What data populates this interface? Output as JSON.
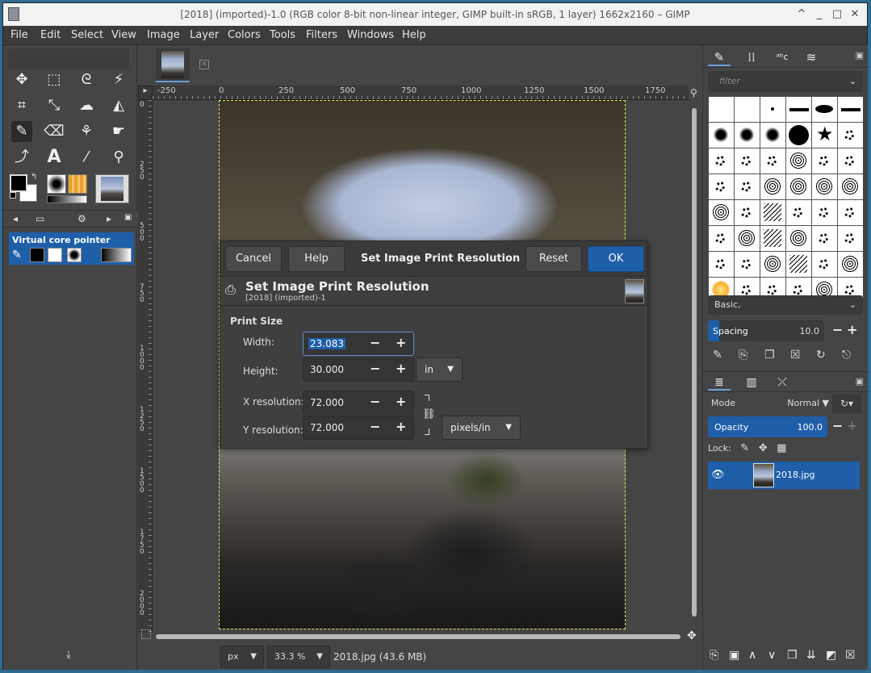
{
  "window": {
    "title": "[2018] (imported)-1.0 (RGB color 8-bit non-linear integer, GIMP built-in sRGB, 1 layer) 1662x2160 – GIMP",
    "controls": [
      "^",
      "_",
      "□",
      "✕"
    ]
  },
  "menubar": [
    "File",
    "Edit",
    "Select",
    "View",
    "Image",
    "Layer",
    "Colors",
    "Tools",
    "Filters",
    "Windows",
    "Help"
  ],
  "toolbox": {
    "tools": [
      "move-tool",
      "rect-select-tool",
      "free-select-tool",
      "fuzzy-select-tool",
      "crop-tool",
      "unified-transform-tool",
      "warp-transform-tool",
      "bucket-fill-tool",
      "paintbrush-tool",
      "eraser-tool",
      "clone-tool",
      "smudge-tool",
      "paths-tool",
      "text-tool",
      "color-picker-tool",
      "zoom-tool"
    ],
    "device_status_label": "Virtual core pointer"
  },
  "canvas": {
    "ruler_h_labels": [
      "-250",
      "0",
      "250",
      "500",
      "750",
      "1000",
      "1250",
      "1500",
      "1750"
    ],
    "ruler_v_labels": [
      "0",
      "250",
      "500",
      "750",
      "1000",
      "1250",
      "1500",
      "1750",
      "2000"
    ]
  },
  "statusbar": {
    "unit": "px",
    "zoom": "33.3 %",
    "info": "2018.jpg (43.6 MB)"
  },
  "dock": {
    "brush_filter_placeholder": "filter",
    "brush_set": "Basic,",
    "spacing_label": "Spacing",
    "spacing_value": "10.0",
    "spacing_fraction": 0.1,
    "mode_label": "Mode",
    "mode_value": "Normal",
    "opacity_label": "Opacity",
    "opacity_value": "100.0",
    "lock_label": "Lock:",
    "layers": [
      {
        "name": "2018.jpg"
      }
    ]
  },
  "dialog": {
    "buttons": {
      "cancel": "Cancel",
      "help": "Help",
      "reset": "Reset",
      "ok": "OK"
    },
    "header_title": "Set Image Print Resolution",
    "title": "Set Image Print Resolution",
    "subtitle": "[2018] (imported)-1",
    "section": "Print Size",
    "width_label": "Width:",
    "width_value": "23.083",
    "height_label": "Height:",
    "height_value": "30.000",
    "size_unit": "in",
    "xres_label": "X resolution:",
    "xres_value": "72.000",
    "yres_label": "Y resolution:",
    "yres_value": "72.000",
    "res_unit": "pixels/in"
  }
}
